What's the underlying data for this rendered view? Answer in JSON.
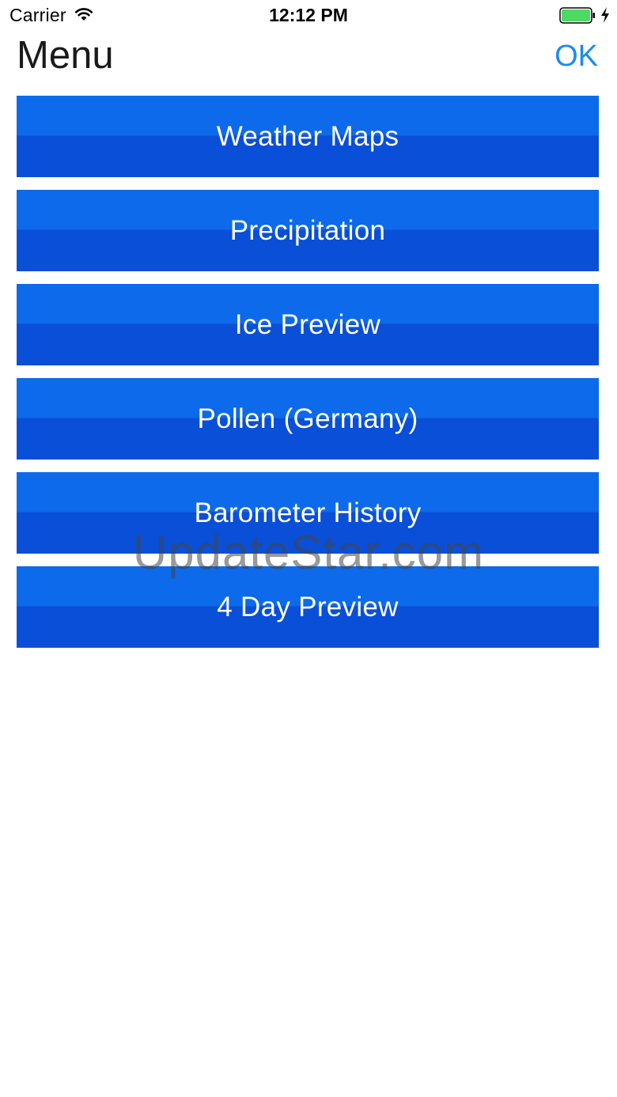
{
  "status_bar": {
    "carrier": "Carrier",
    "time": "12:12 PM",
    "wifi_icon": "wifi-icon",
    "battery_icon": "battery-icon",
    "charging_icon": "charging-bolt-icon",
    "battery_color": "#4cd964"
  },
  "header": {
    "title": "Menu",
    "ok_label": "OK",
    "accent_color": "#1a8cf0"
  },
  "menu": {
    "items": [
      {
        "label": "Weather Maps"
      },
      {
        "label": "Precipitation"
      },
      {
        "label": "Ice Preview"
      },
      {
        "label": "Pollen (Germany)"
      },
      {
        "label": "Barometer History"
      },
      {
        "label": "4 Day Preview"
      }
    ],
    "button_color_top": "#0d6aea",
    "button_color_bottom": "#0a4fd8"
  },
  "watermark": {
    "text": "UpdateStar.com"
  }
}
